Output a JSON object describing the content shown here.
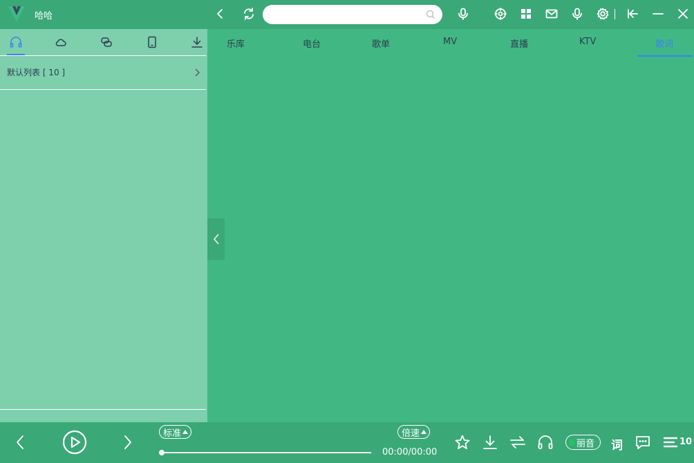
{
  "app": {
    "title": "哈哈"
  },
  "search": {
    "value": "",
    "placeholder": ""
  },
  "sidebar": {
    "playlist": {
      "label": "默认列表 [ 10 ]"
    }
  },
  "nav_tabs": [
    "乐库",
    "电台",
    "歌单",
    "MV",
    "直播",
    "KTV",
    "歌词"
  ],
  "player": {
    "quality_mode": "标准",
    "speed_label": "倍速",
    "time": "00:00/00:00",
    "progress": 0,
    "sound_quality": "丽音",
    "lyrics_label": "词",
    "queue_count": "10"
  },
  "colors": {
    "background": "#41b883",
    "titlebar": "#3aa877",
    "sidebar": "#7ecfac",
    "accent": "#3b82f6"
  },
  "icons": [
    "vue-logo-icon",
    "back-icon",
    "refresh-icon",
    "mic-icon",
    "target-icon",
    "grid-icon",
    "mail-icon",
    "mic2-icon",
    "settings-icon",
    "collapse-left-icon",
    "minimize-icon",
    "close-icon",
    "headphones-icon",
    "cloud-icon",
    "link-icon",
    "device-icon",
    "download-icon",
    "prev-icon",
    "play-icon",
    "next-icon",
    "star-icon",
    "download2-icon",
    "loop-icon",
    "headphones2-icon",
    "comment-icon",
    "queue-icon"
  ]
}
